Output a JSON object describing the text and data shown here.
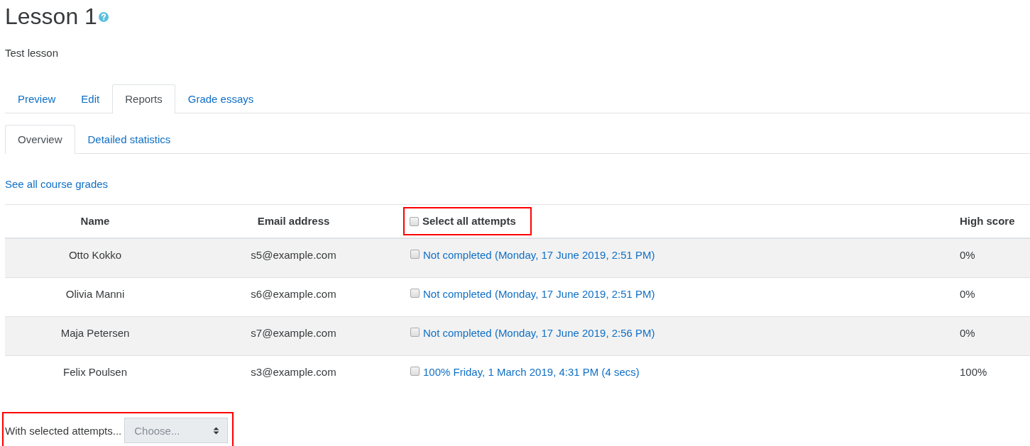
{
  "title": "Lesson 1",
  "description": "Test lesson",
  "tabs": [
    {
      "label": "Preview",
      "selected": false
    },
    {
      "label": "Edit",
      "selected": false
    },
    {
      "label": "Reports",
      "selected": true
    },
    {
      "label": "Grade essays",
      "selected": false
    }
  ],
  "subtabs": [
    {
      "label": "Overview",
      "selected": true
    },
    {
      "label": "Detailed statistics",
      "selected": false
    }
  ],
  "course_grades_link": "See all course grades",
  "table": {
    "columns": [
      "Name",
      "Email address",
      "Select all attempts",
      "High score"
    ],
    "select_all_checked": false,
    "rows": [
      {
        "name": "Otto Kokko",
        "email": "s5@example.com",
        "attempt": "Not completed (Monday, 17 June 2019, 2:51 PM)",
        "checked": false,
        "high_score": "0%"
      },
      {
        "name": "Olivia Manni",
        "email": "s6@example.com",
        "attempt": "Not completed (Monday, 17 June 2019, 2:51 PM)",
        "checked": false,
        "high_score": "0%"
      },
      {
        "name": "Maja Petersen",
        "email": "s7@example.com",
        "attempt": "Not completed (Monday, 17 June 2019, 2:56 PM)",
        "checked": false,
        "high_score": "0%"
      },
      {
        "name": "Felix Poulsen",
        "email": "s3@example.com",
        "attempt": "100% Friday, 1 March 2019, 4:31 PM (4 secs)",
        "checked": false,
        "high_score": "100%"
      }
    ]
  },
  "bulk_action": {
    "label": "With selected attempts...",
    "placeholder": "Choose...",
    "disabled": true
  }
}
